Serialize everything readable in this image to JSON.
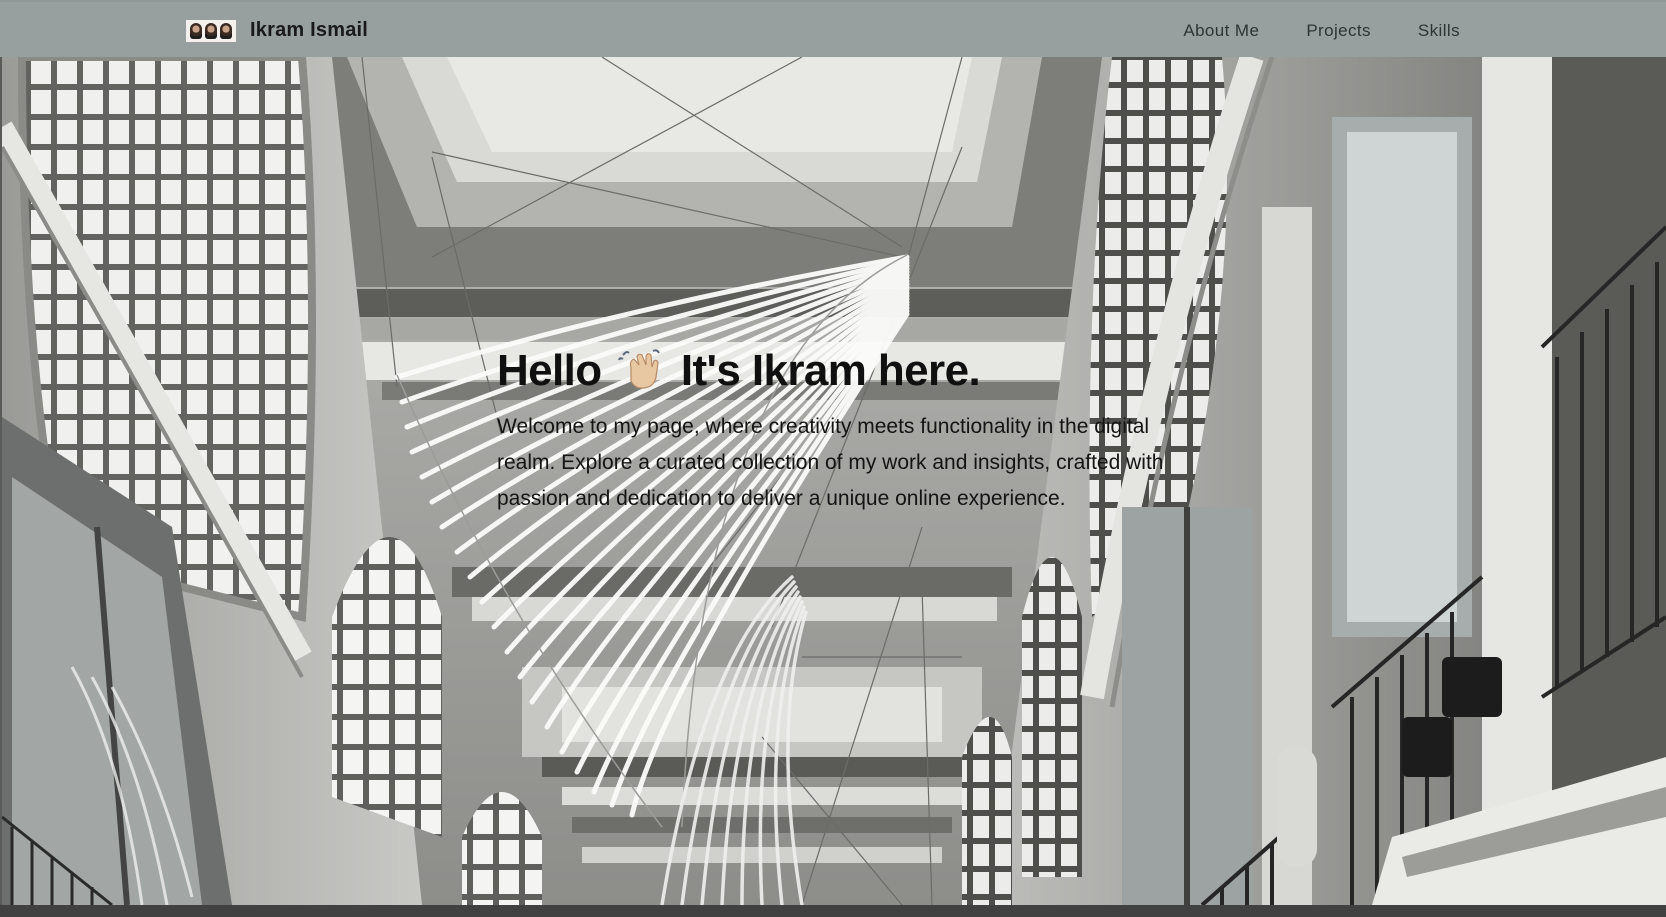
{
  "navbar": {
    "brand_name": "Ikram Ismail",
    "logo_icon": "portrait-strip-logo",
    "links": [
      {
        "label": "About Me"
      },
      {
        "label": "Projects"
      },
      {
        "label": "Skills"
      }
    ],
    "background": "#97a09f"
  },
  "hero": {
    "heading_part1": "Hello",
    "heading_icon": "waving-hand-icon",
    "heading_part2": "It's Ikram here.",
    "paragraph": "Welcome to my page, where creativity meets functionality in the digital realm. Explore a curated collection of my work and insights, crafted with passion and dedication to deliver a unique online experience.",
    "background_image": "arcade-ceiling-light-sculpture-photo"
  }
}
